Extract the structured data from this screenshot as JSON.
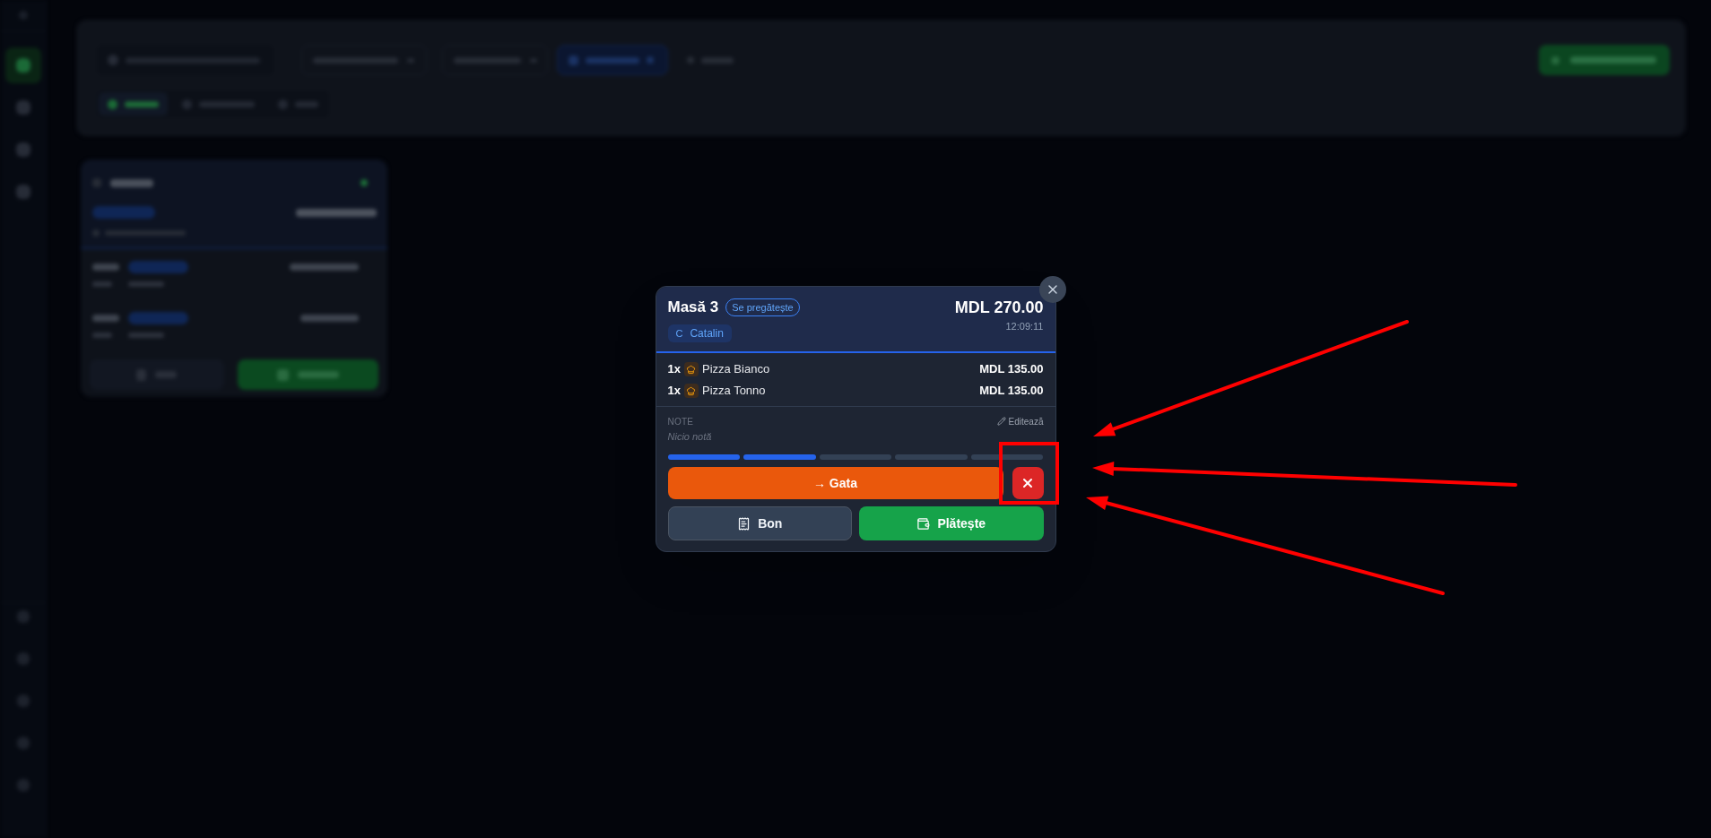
{
  "background": {
    "sidebar": {
      "nav_items": [
        {
          "selected": true
        },
        {
          "selected": false
        },
        {
          "selected": false
        },
        {
          "selected": false
        }
      ]
    },
    "filter_tabs": [
      {
        "selected": true
      },
      {
        "selected": false
      },
      {
        "selected": false
      }
    ]
  },
  "modal": {
    "title": "Masă 3",
    "status": "Se pregătește",
    "total": "MDL 270.00",
    "time": "12:09:11",
    "waiter": {
      "initial": "C",
      "name": "Catalin"
    },
    "items": [
      {
        "qty": "1x",
        "name": "Pizza Bianco",
        "price": "MDL 135.00"
      },
      {
        "qty": "1x",
        "name": "Pizza Tonno",
        "price": "MDL 135.00"
      }
    ],
    "notes": {
      "label": "NOTE",
      "edit": "Editează",
      "text": "Nicio notă"
    },
    "progress": [
      {
        "done": true
      },
      {
        "done": true
      },
      {
        "done": false
      },
      {
        "done": false
      },
      {
        "done": false
      }
    ],
    "next_action": "→ Gata",
    "buttons": [
      {
        "kind": "receipt",
        "label": "Bon"
      },
      {
        "kind": "pay",
        "label": "Plătește"
      }
    ]
  }
}
